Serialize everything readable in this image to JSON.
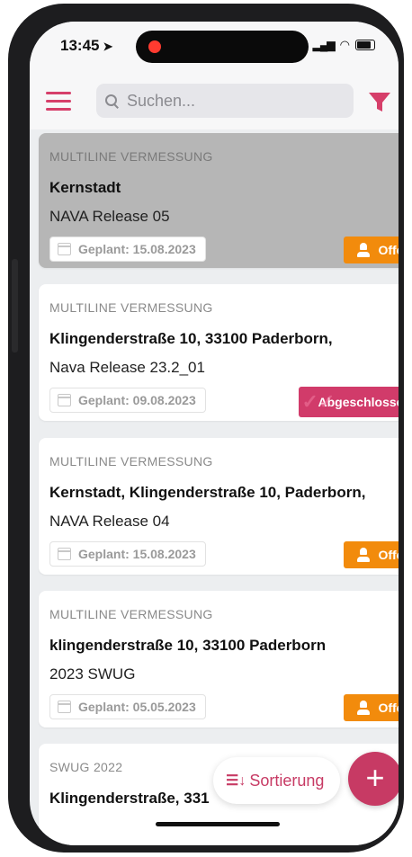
{
  "status_bar": {
    "time": "13:45"
  },
  "header": {
    "search_placeholder": "Suchen..."
  },
  "items": [
    {
      "type": "MULTILINE VERMESSUNG",
      "title": "Kernstadt",
      "subtitle": "NAVA Release 05",
      "date": "Geplant: 15.08.2023",
      "status": "Offen",
      "selected": true
    },
    {
      "type": "MULTILINE VERMESSUNG",
      "title": "Klingenderstraße 10, 33100 Paderborn,",
      "subtitle": "Nava Release 23.2_01",
      "date": "Geplant: 09.08.2023",
      "status": "Abgeschlossen",
      "selected": false
    },
    {
      "type": "MULTILINE VERMESSUNG",
      "title": "Kernstadt, Klingenderstraße 10, Paderborn,",
      "subtitle": "NAVA Release 04",
      "date": "Geplant: 15.08.2023",
      "status": "Offen",
      "selected": false
    },
    {
      "type": "MULTILINE VERMESSUNG",
      "title": "klingenderstraße 10, 33100 Paderborn",
      "subtitle": "2023 SWUG",
      "date": "Geplant: 05.05.2023",
      "status": "Offen",
      "selected": false
    },
    {
      "type": "SWUG 2022",
      "title": "Klingenderstraße, 331",
      "subtitle": "",
      "date": "",
      "status": "",
      "selected": false
    }
  ],
  "sort_button": {
    "label": "Sortierung"
  },
  "fab": {
    "label": "+"
  },
  "colors": {
    "accent": "#d13b6a",
    "open": "#f28b0c",
    "done": "#d13b6a",
    "selected_bg": "#b6b6b6"
  }
}
